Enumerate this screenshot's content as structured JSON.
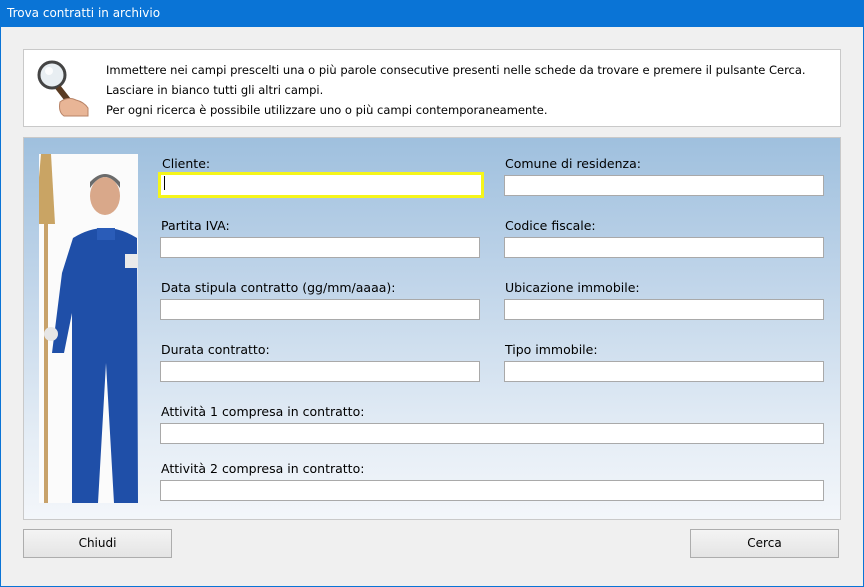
{
  "window": {
    "title": "Trova contratti in archivio"
  },
  "info": {
    "lines": [
      "Immettere nei campi prescelti una o più parole consecutive presenti nelle schede da trovare e premere il pulsante Cerca.",
      "Lasciare in bianco tutti gli altri campi.",
      "Per ogni ricerca è possibile utilizzare uno o più campi contemporaneamente."
    ]
  },
  "form": {
    "cliente": {
      "label": "Cliente:",
      "value": ""
    },
    "comune": {
      "label": "Comune di residenza:",
      "value": ""
    },
    "partita_iva": {
      "label": "Partita IVA:",
      "value": ""
    },
    "codice_fiscale": {
      "label": "Codice fiscale:",
      "value": ""
    },
    "data_stipula": {
      "label": "Data stipula contratto (gg/mm/aaaa):",
      "value": ""
    },
    "ubicazione": {
      "label": "Ubicazione immobile:",
      "value": ""
    },
    "durata": {
      "label": "Durata contratto:",
      "value": ""
    },
    "tipo_immobile": {
      "label": "Tipo immobile:",
      "value": ""
    },
    "attivita1": {
      "label": "Attività 1 compresa in contratto:",
      "value": ""
    },
    "attivita2": {
      "label": "Attività 2 compresa in contratto:",
      "value": ""
    }
  },
  "buttons": {
    "close": "Chiudi",
    "search": "Cerca"
  },
  "colors": {
    "titlebar": "#0a74d6",
    "focus_border": "#f5f51a",
    "uniform": "#1f4fa8"
  }
}
